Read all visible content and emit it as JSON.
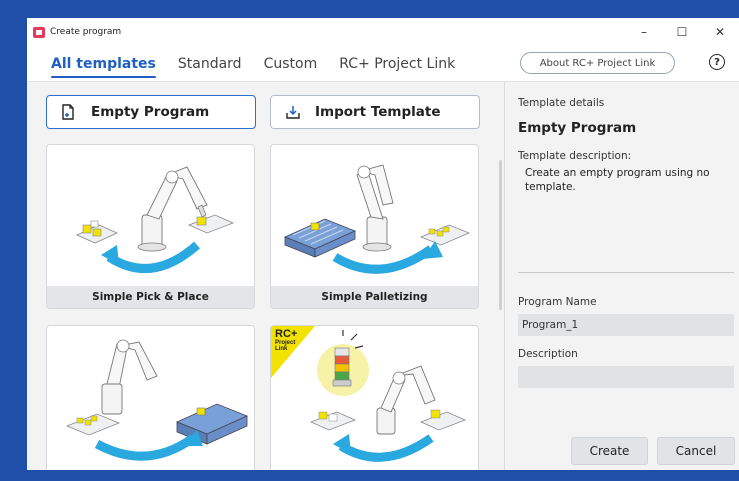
{
  "window": {
    "title": "Create program"
  },
  "tabs": [
    {
      "label": "All templates",
      "active": true
    },
    {
      "label": "Standard",
      "active": false
    },
    {
      "label": "Custom",
      "active": false
    },
    {
      "label": "RC+ Project Link",
      "active": false
    }
  ],
  "header": {
    "about_label": "About RC+ Project Link",
    "help_glyph": "?"
  },
  "actions": {
    "empty_label": "Empty Program",
    "import_label": "Import Template"
  },
  "templates": [
    {
      "label": "Simple Pick & Place"
    },
    {
      "label": "Simple Palletizing"
    },
    {
      "label": ""
    },
    {
      "label": "",
      "badge": {
        "line1": "RC+",
        "line2": "Project",
        "line3": "Link"
      }
    }
  ],
  "details": {
    "section_label": "Template details",
    "name": "Empty Program",
    "desc_label": "Template description:",
    "description": "Create an empty program using no template.",
    "program_name_label": "Program Name",
    "program_name_value": "Program_1",
    "description_label": "Description",
    "description_value": "",
    "create_label": "Create",
    "cancel_label": "Cancel"
  },
  "colors": {
    "accent": "#1d5fc2",
    "arrow": "#2aa8e0",
    "badge": "#f2e200",
    "frame": "#1f4fa8"
  }
}
